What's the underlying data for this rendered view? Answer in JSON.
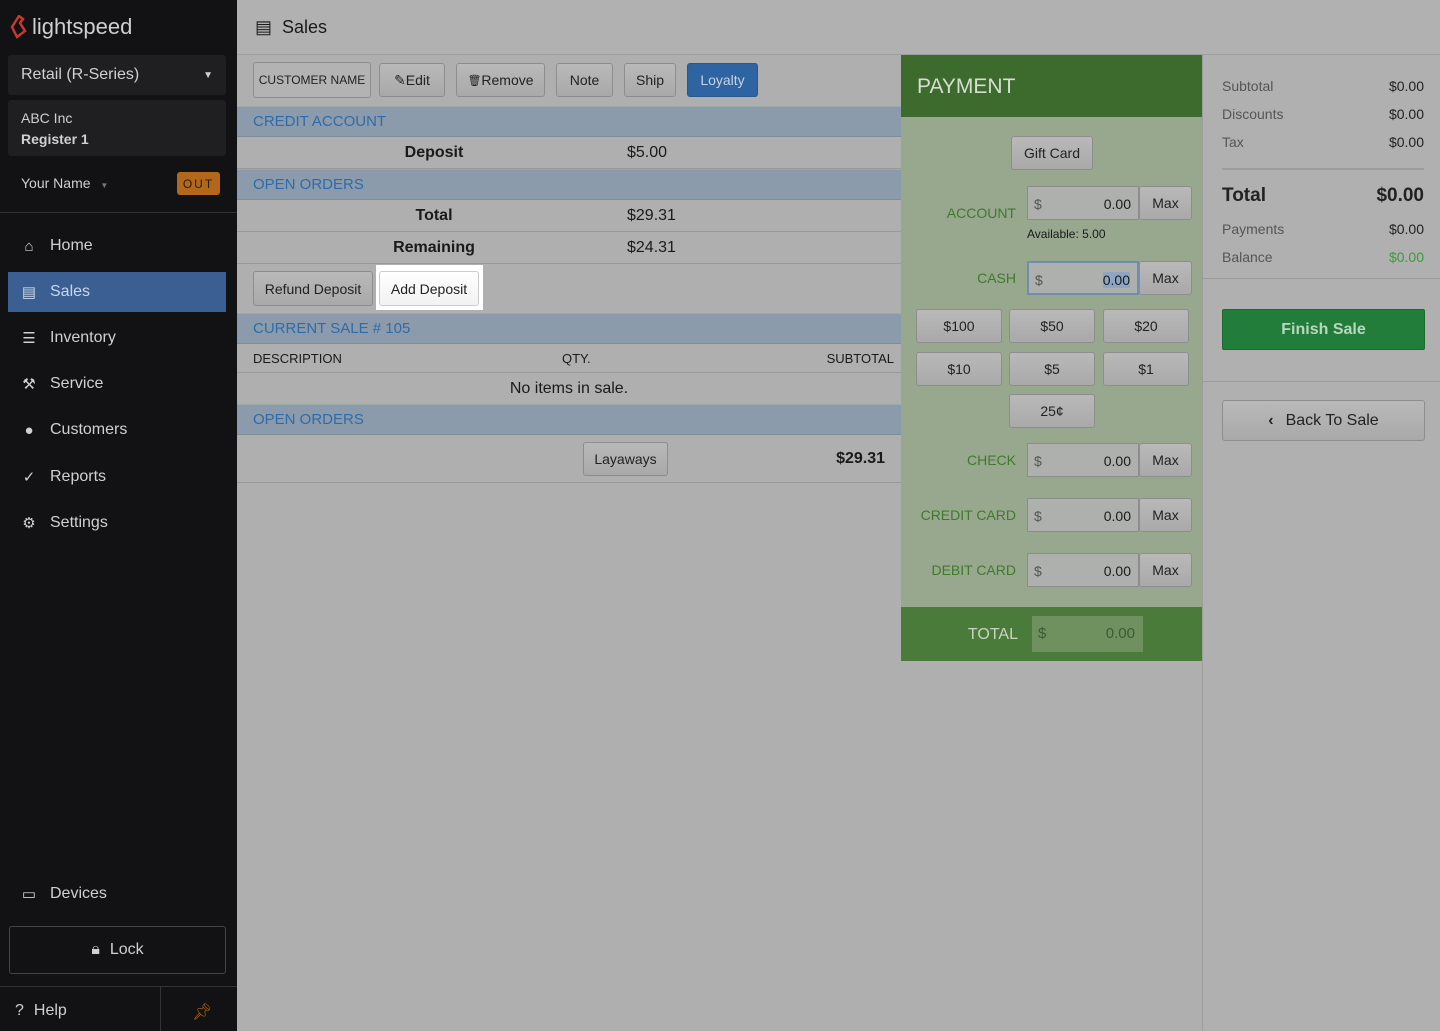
{
  "brand": {
    "name": "lightspeed",
    "logo_color": "#c33a32"
  },
  "sidebar": {
    "product": "Retail (R-Series)",
    "company": "ABC Inc",
    "register": "Register 1",
    "user": "Your Name",
    "status_badge": "OUT",
    "items": [
      {
        "label": "Home",
        "icon": "home-icon"
      },
      {
        "label": "Sales",
        "icon": "register-icon",
        "active": true
      },
      {
        "label": "Inventory",
        "icon": "inventory-icon"
      },
      {
        "label": "Service",
        "icon": "hammer-icon"
      },
      {
        "label": "Customers",
        "icon": "user-icon"
      },
      {
        "label": "Reports",
        "icon": "chart-icon"
      },
      {
        "label": "Settings",
        "icon": "gear-icon"
      }
    ],
    "devices": "Devices",
    "lock": "Lock",
    "help": "Help"
  },
  "header": {
    "title": "Sales"
  },
  "toolbar": {
    "customer_name": "CUSTOMER NAME",
    "edit": "Edit",
    "remove": "Remove",
    "note": "Note",
    "ship": "Ship",
    "loyalty": "Loyalty"
  },
  "credit_account": {
    "title": "CREDIT ACCOUNT",
    "deposit_label": "Deposit",
    "deposit_value": "$5.00"
  },
  "open_orders": {
    "title": "OPEN ORDERS",
    "total_label": "Total",
    "total_value": "$29.31",
    "remaining_label": "Remaining",
    "remaining_value": "$24.31",
    "refund_deposit": "Refund Deposit",
    "add_deposit": "Add Deposit"
  },
  "current_sale": {
    "title": "CURRENT SALE # 105",
    "columns": [
      "DESCRIPTION",
      "QTY.",
      "SUBTOTAL"
    ],
    "empty": "No items in sale."
  },
  "open_orders2": {
    "title": "OPEN ORDERS",
    "layaways": "Layaways",
    "amount": "$29.31"
  },
  "payment": {
    "title": "PAYMENT",
    "gift_card": "Gift Card",
    "currency": "$",
    "max": "Max",
    "account": {
      "label": "ACCOUNT",
      "value": "0.00",
      "available": "Available: 5.00"
    },
    "cash": {
      "label": "CASH",
      "value": "0.00"
    },
    "quick": [
      "$100",
      "$50",
      "$20",
      "$10",
      "$5",
      "$1",
      "25¢"
    ],
    "check": {
      "label": "CHECK",
      "value": "0.00"
    },
    "credit_card": {
      "label": "CREDIT CARD",
      "value": "0.00"
    },
    "debit_card": {
      "label": "DEBIT CARD",
      "value": "0.00"
    },
    "total": {
      "label": "TOTAL",
      "value": "0.00"
    }
  },
  "summary": {
    "subtotal_label": "Subtotal",
    "subtotal": "$0.00",
    "discounts_label": "Discounts",
    "discounts": "$0.00",
    "tax_label": "Tax",
    "tax": "$0.00",
    "total_label": "Total",
    "total": "$0.00",
    "payments_label": "Payments",
    "payments": "$0.00",
    "balance_label": "Balance",
    "balance": "$0.00",
    "finish": "Finish Sale",
    "back": "Back To Sale"
  }
}
